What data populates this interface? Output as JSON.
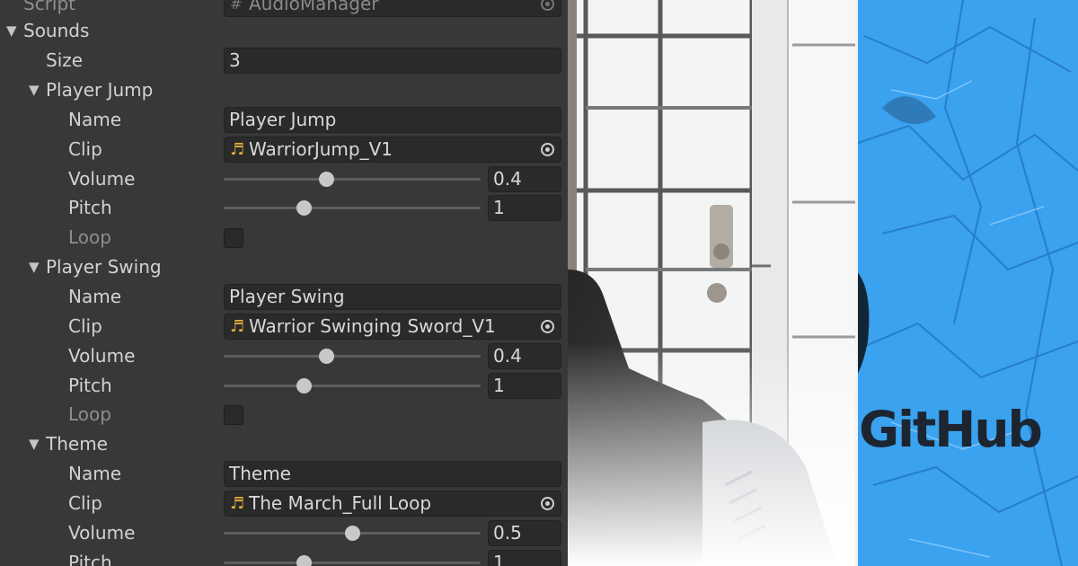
{
  "inspector": {
    "script": {
      "label": "Script",
      "value": "AudioManager"
    },
    "sounds": {
      "label": "Sounds",
      "size_label": "Size",
      "size_value": "3"
    },
    "labels": {
      "name": "Name",
      "clip": "Clip",
      "volume": "Volume",
      "pitch": "Pitch",
      "loop": "Loop"
    },
    "items": [
      {
        "header": "Player Jump",
        "name": "Player Jump",
        "clip": "WarriorJump_V1",
        "volume": "0.4",
        "volume_fraction": 0.4,
        "pitch": "1",
        "pitch_fraction": 0.31,
        "loop": false
      },
      {
        "header": "Player Swing",
        "name": "Player Swing",
        "clip": "Warrior Swinging Sword_V1",
        "volume": "0.4",
        "volume_fraction": 0.4,
        "pitch": "1",
        "pitch_fraction": 0.31,
        "loop": false
      },
      {
        "header": "Theme",
        "name": "Theme",
        "clip": "The March_Full Loop",
        "volume": "0.5",
        "volume_fraction": 0.5,
        "pitch": "1",
        "pitch_fraction": 0.31
      }
    ]
  },
  "banner": {
    "logo_text": "GitHub"
  },
  "icons": {
    "foldout": "triangle-down-icon",
    "audio_clip": "music-note-icon",
    "object_picker": "target-icon",
    "script": "hash-icon"
  },
  "colors": {
    "panel_bg": "#383838",
    "field_bg": "#2a2a2a",
    "label_text": "#d2d2d2",
    "clip_icon": "#e5b23a",
    "github_blue": "#3aa2ef",
    "github_text": "#1c2530"
  }
}
